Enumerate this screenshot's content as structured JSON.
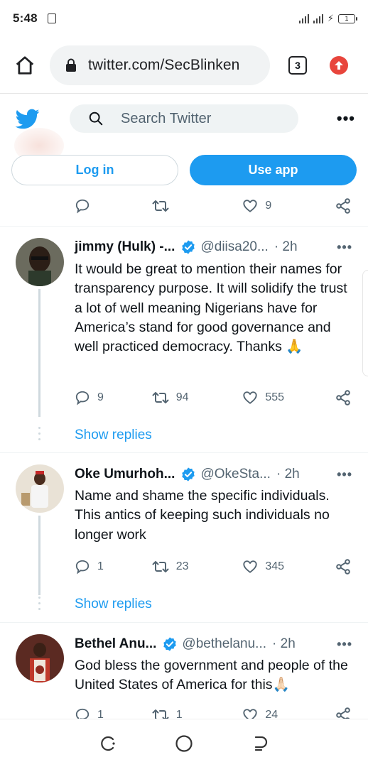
{
  "status_bar": {
    "time": "5:48",
    "battery": "1"
  },
  "browser": {
    "url": "twitter.com/SecBlinken",
    "tab_count": "3"
  },
  "header": {
    "search_placeholder": "Search Twitter",
    "more": "•••"
  },
  "auth": {
    "login_label": "Log in",
    "app_label": "Use app"
  },
  "top_actions": {
    "reply": "",
    "retweets": "",
    "likes": "9"
  },
  "tweets": [
    {
      "name": "jimmy (Hulk) -...",
      "handle": "@diisa20...",
      "time": "· 2h",
      "text": "It would be great to mention their names for transparency purpose. It will solidify the trust a lot of well meaning Nigerians have for America’s stand for good governance and well practiced democracy. Thanks 🙏",
      "replies": "9",
      "retweets": "94",
      "likes": "555",
      "show_replies": "Show replies"
    },
    {
      "name": "Oke Umurhoh...",
      "handle": "@OkeSta...",
      "time": "· 2h",
      "text": "Name and shame the specific individuals. This antics of keeping such individuals no longer work",
      "replies": "1",
      "retweets": "23",
      "likes": "345",
      "show_replies": "Show replies"
    },
    {
      "name": "Bethel Anu...",
      "handle": "@bethelanu...",
      "time": "· 2h",
      "text": "God bless the government and people of the United States of America for this🙏🏻",
      "replies": "1",
      "retweets": "1",
      "likes": "24"
    }
  ],
  "colors": {
    "accent": "#1d9bf0",
    "text": "#0f1419",
    "secondary": "#536471",
    "divider": "#eff3f4"
  }
}
